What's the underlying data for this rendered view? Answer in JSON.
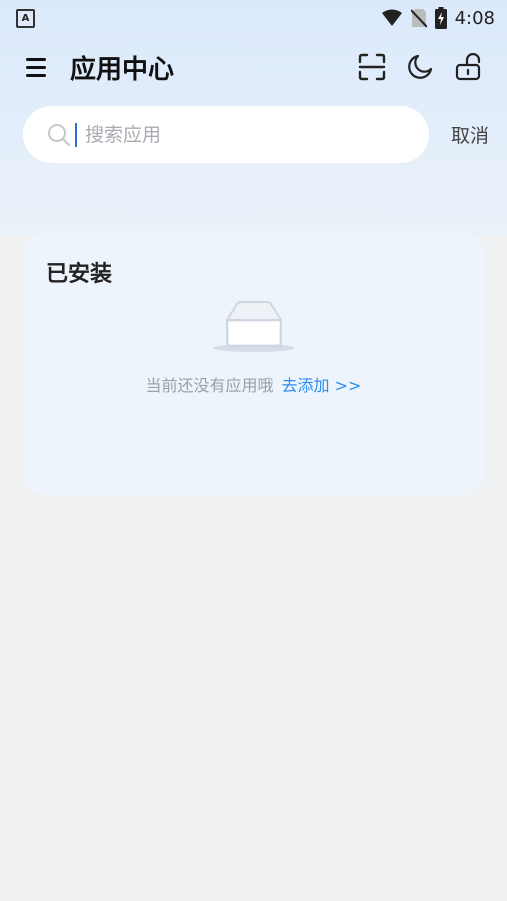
{
  "status_bar": {
    "time": "4:08",
    "notification_letter": "A"
  },
  "header": {
    "title": "应用中心"
  },
  "search": {
    "placeholder": "搜索应用",
    "value": "",
    "cancel_label": "取消"
  },
  "installed": {
    "title": "已安装",
    "empty_text": "当前还没有应用哦",
    "add_link": "去添加 >>"
  },
  "colors": {
    "accent": "#2d8cf0",
    "background": "#eff1f3",
    "card": "#eef4fc"
  }
}
